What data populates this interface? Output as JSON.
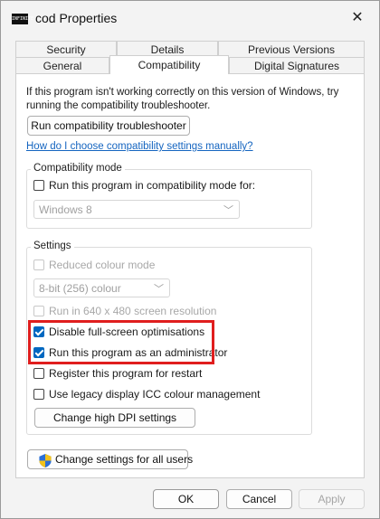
{
  "window": {
    "title": "cod Properties",
    "app_icon_text": "INFINITE",
    "close_glyph": "✕"
  },
  "tabs": {
    "row1": [
      "Security",
      "Details",
      "Previous Versions"
    ],
    "row2": [
      "General",
      "Compatibility",
      "Digital Signatures"
    ],
    "active": "Compatibility"
  },
  "compat": {
    "intro": "If this program isn't working correctly on this version of Windows, try running the compatibility troubleshooter.",
    "troubleshooter_label": "Run compatibility troubleshooter",
    "manual_link": "How do I choose compatibility settings manually?",
    "mode_group": {
      "legend": "Compatibility mode",
      "checkbox_label": "Run this program in compatibility mode for:",
      "checked": false,
      "select_value": "Windows 8"
    },
    "settings_group": {
      "legend": "Settings",
      "reduced_colour_label": "Reduced colour mode",
      "colour_select_value": "8-bit (256) colour",
      "res_640_label": "Run in 640 x 480 screen resolution",
      "fullscreen_label": "Disable full-screen optimisations",
      "fullscreen_checked": true,
      "admin_label": "Run this program as an administrator",
      "admin_checked": true,
      "restart_label": "Register this program for restart",
      "restart_checked": false,
      "icc_label": "Use legacy display ICC colour management",
      "icc_checked": false,
      "dpi_button": "Change high DPI settings"
    },
    "all_users_button": "Change settings for all users"
  },
  "footer": {
    "ok": "OK",
    "cancel": "Cancel",
    "apply": "Apply"
  },
  "colors": {
    "accent": "#0067c0",
    "highlight_box": "#e01e1e",
    "link": "#1565c0"
  },
  "icons": {
    "app": "app-icon",
    "close": "close-icon",
    "shield": "uac-shield-icon",
    "chevron": "chevron-down-icon"
  }
}
